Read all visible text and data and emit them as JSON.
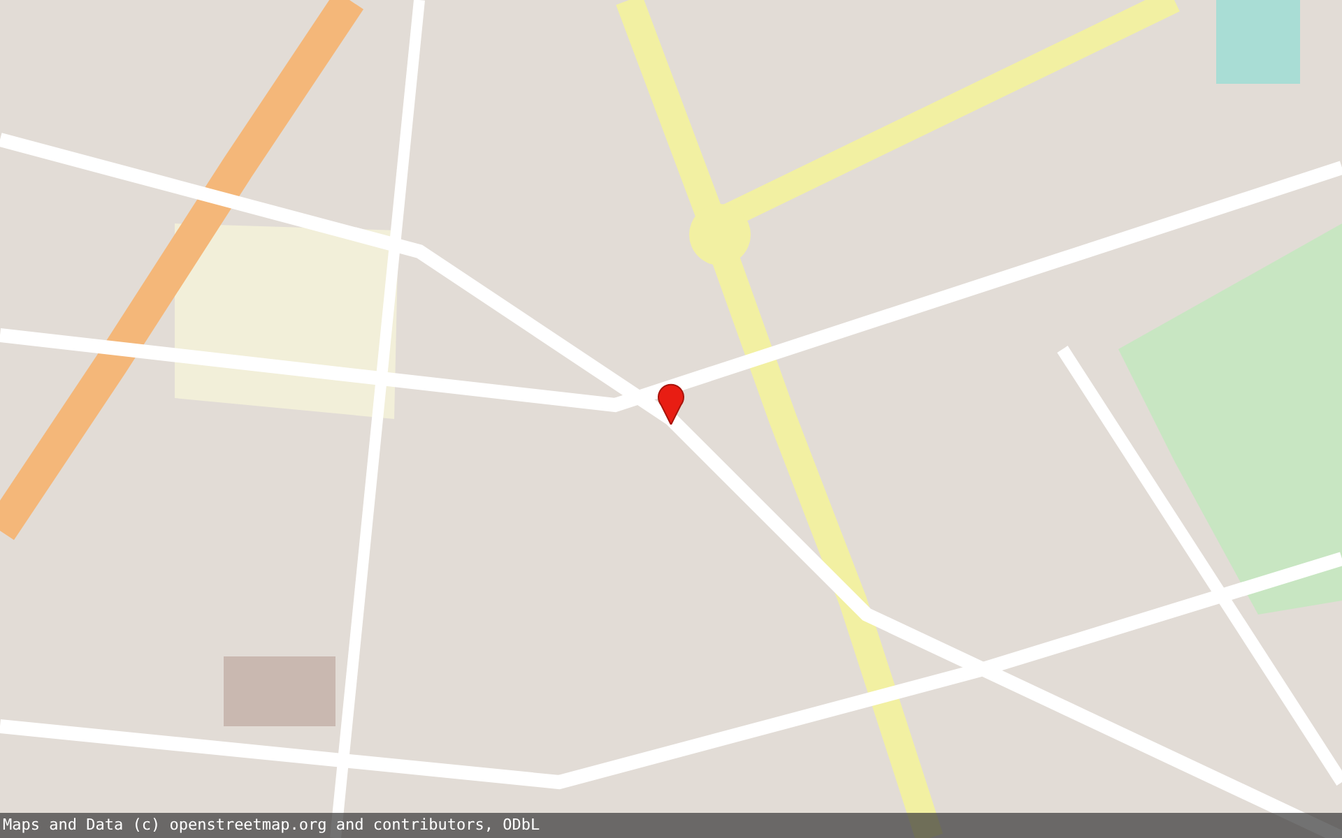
{
  "attribution": "Maps and Data (c) openstreetmap.org and contributors, ODbL"
}
